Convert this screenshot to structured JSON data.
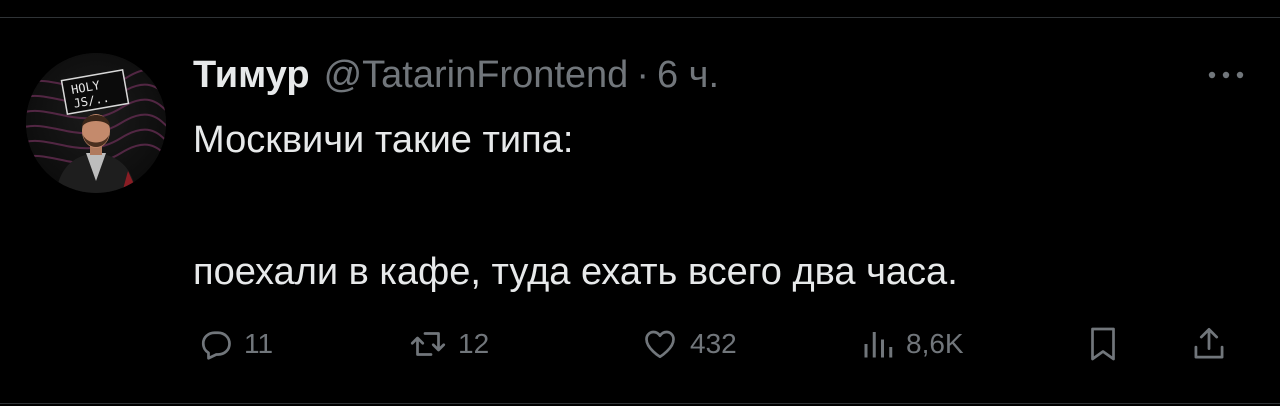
{
  "tweet": {
    "display_name": "Тимур",
    "handle": "@TatarinFrontend",
    "separator": "·",
    "time": "6 ч.",
    "text_line_1": "Москвичи такие типа:",
    "text_line_2": "поехали в кафе, туда ехать всего два часа.",
    "avatar_badge": "HOLY JS/..."
  },
  "actions": {
    "reply_count": "11",
    "retweet_count": "12",
    "like_count": "432",
    "views_count": "8,6K"
  },
  "colors": {
    "background": "#000000",
    "text_primary": "#e7e9ea",
    "text_secondary": "#71767b",
    "divider": "#2f3336"
  },
  "icons": {
    "more": "more-horizontal-icon",
    "reply": "reply-icon",
    "retweet": "retweet-icon",
    "like": "heart-icon",
    "views": "views-chart-icon",
    "bookmark": "bookmark-icon",
    "share": "share-icon"
  }
}
